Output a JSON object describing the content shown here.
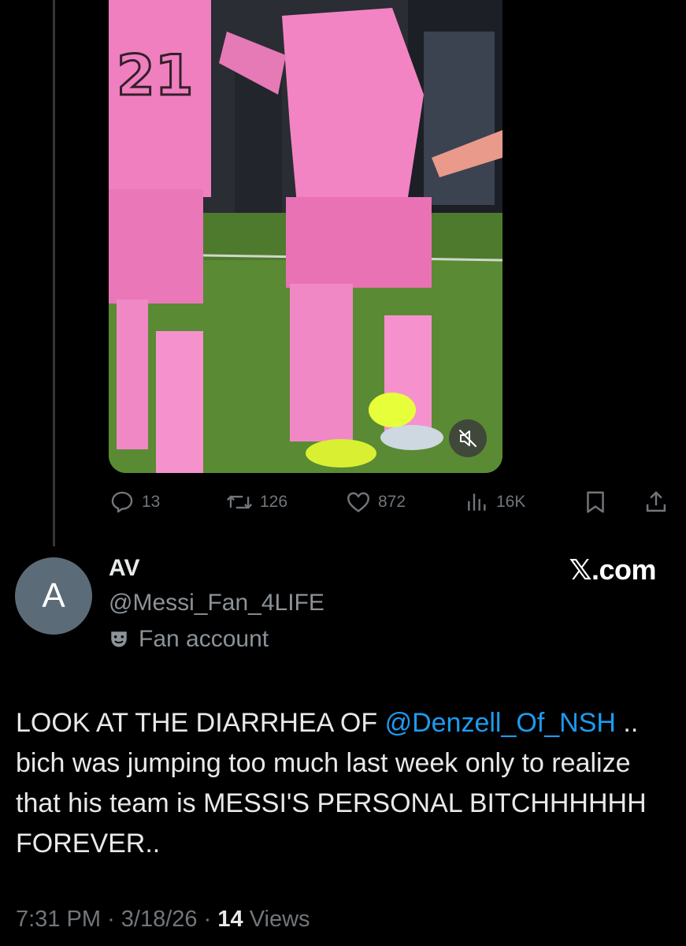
{
  "post_actions": {
    "replies": "13",
    "reposts": "126",
    "likes": "872",
    "views": "16K"
  },
  "author": {
    "avatar_letter": "A",
    "display_name": "AV",
    "handle": "@Messi_Fan_4LIFE",
    "badge_text": "Fan account"
  },
  "watermark": "𝕏.com",
  "tweet": {
    "text_before": "LOOK AT THE DIARRHEA OF ",
    "mention": "@Denzell_Of_NSH",
    "text_after": " .. bich was jumping too much last week only to realize that his team is MESSI'S PERSONAL BITCHHHHHH FOREVER.."
  },
  "meta": {
    "time": "7:31 PM",
    "separator": "·",
    "date": "3/18/26",
    "views_count": "14",
    "views_label": "Views"
  },
  "colors": {
    "background": "#000000",
    "text": "#e7e9ea",
    "muted": "#71767b",
    "link": "#1d9bf0",
    "avatar_bg": "#5b6b78",
    "jersey_pink": "#f28bc5"
  }
}
